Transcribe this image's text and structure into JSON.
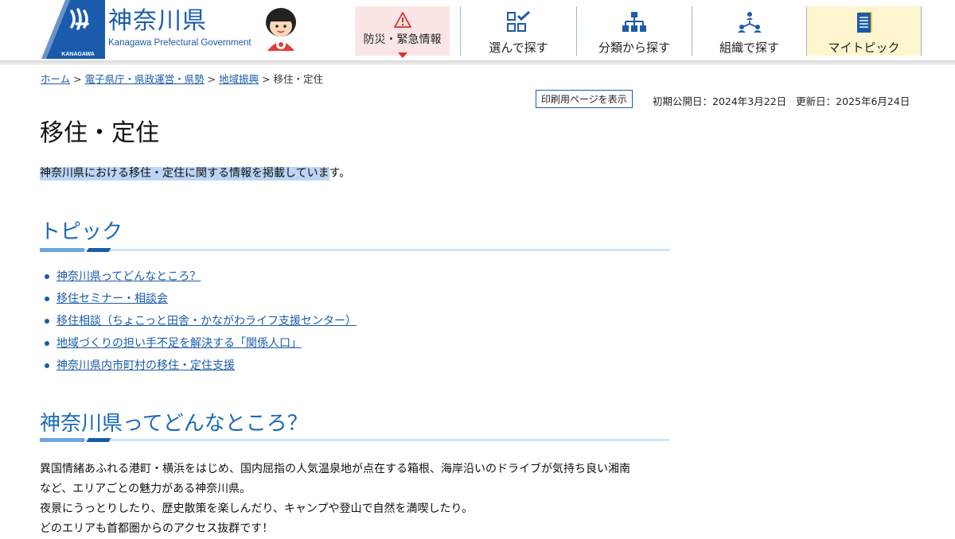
{
  "header": {
    "logo_title": "神奈川県",
    "logo_subtitle": "Kanagawa Prefectural Government",
    "logo_band_text": "KANAGAWA",
    "nav": [
      {
        "label": "防災・緊急情報",
        "icon": "warning-icon"
      },
      {
        "label": "選んで探す",
        "icon": "checklist-icon"
      },
      {
        "label": "分類から探す",
        "icon": "hierarchy-icon"
      },
      {
        "label": "組織で探す",
        "icon": "organization-icon"
      },
      {
        "label": "マイトピック",
        "icon": "notebook-icon"
      }
    ]
  },
  "breadcrumb": {
    "items": [
      "ホーム",
      "電子県庁・県政運営・県勢",
      "地域振興"
    ],
    "current": "移住・定住",
    "separator": ">"
  },
  "meta": {
    "print_label": "印刷用ページを表示",
    "published": "初期公開日：2024年3月22日",
    "updated": "更新日：2025年6月24日"
  },
  "page": {
    "title": "移住・定住",
    "intro_selected": "神奈川県における移住・定住に関する情報を掲載していま",
    "intro_rest": "す。"
  },
  "topics": {
    "heading": "トピック",
    "links": [
      "神奈川県ってどんなところ？",
      "移住セミナー・相談会",
      "移住相談（ちょこっと田舎・かながわライフ支援センター）",
      "地域づくりの担い手不足を解決する「関係人口」",
      "神奈川県内市町村の移住・定住支援"
    ]
  },
  "section": {
    "heading": "神奈川県ってどんなところ？",
    "paragraphs": [
      "異国情緒あふれる港町・横浜をはじめ、国内屈指の人気温泉地が点在する箱根、海岸沿いのドライブが気持ち良い湘南",
      "など、エリアごとの魅力がある神奈川県。",
      "夜景にうっとりしたり、歴史散策を楽しんだり、キャンプや登山で自然を満喫したり。",
      "どのエリアも首都圏からのアクセス抜群です！"
    ]
  },
  "colors": {
    "brand_blue": "#1a5bab",
    "heading_blue": "#1a6ab8",
    "selection": "#bcd4f5",
    "bousai_bg": "#fbe6e6",
    "alert_red": "#d93030",
    "mytopic_bg": "#fff6cf"
  }
}
